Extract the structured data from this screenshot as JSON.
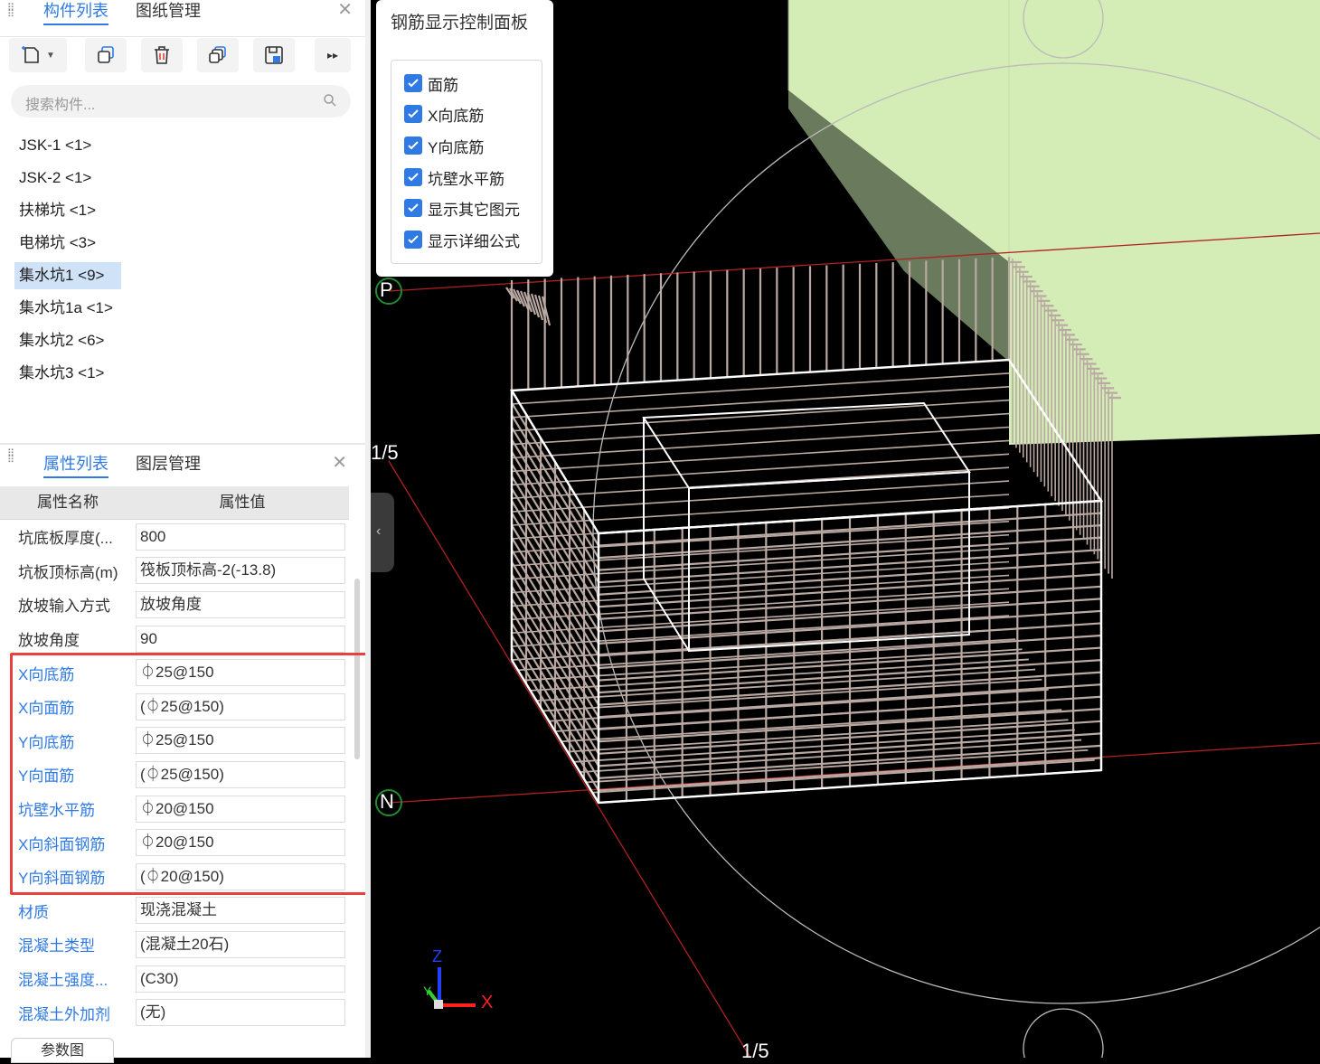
{
  "top_panel": {
    "tabs": [
      "构件列表",
      "图纸管理"
    ],
    "search_placeholder": "搜索构件...",
    "items": [
      "JSK-1 <1>",
      "JSK-2 <1>",
      "扶梯坑 <1>",
      "电梯坑 <3>",
      "集水坑1 <9>",
      "集水坑1a <1>",
      "集水坑2 <6>",
      "集水坑3 <1>"
    ],
    "selected_index": 4
  },
  "bottom_panel": {
    "tabs": [
      "属性列表",
      "图层管理"
    ],
    "headers": [
      "属性名称",
      "属性值"
    ],
    "rows": [
      {
        "name": "坑底板厚度(...",
        "value": "800",
        "blue": false
      },
      {
        "name": "坑板顶标高(m)",
        "value": "筏板顶标高-2(-13.8)",
        "blue": false
      },
      {
        "name": "放坡输入方式",
        "value": "放坡角度",
        "blue": false
      },
      {
        "name": "放坡角度",
        "value": "90",
        "blue": false
      },
      {
        "name": "X向底筋",
        "value": "⏀25@150",
        "blue": true
      },
      {
        "name": "X向面筋",
        "value": "(⏀25@150)",
        "blue": true
      },
      {
        "name": "Y向底筋",
        "value": "⏀25@150",
        "blue": true
      },
      {
        "name": "Y向面筋",
        "value": "(⏀25@150)",
        "blue": true
      },
      {
        "name": "坑壁水平筋",
        "value": "⏀20@150",
        "blue": true
      },
      {
        "name": "X向斜面钢筋",
        "value": "⏀20@150",
        "blue": true
      },
      {
        "name": "Y向斜面钢筋",
        "value": "(⏀20@150)",
        "blue": true
      },
      {
        "name": "材质",
        "value": "现浇混凝土",
        "blue": true
      },
      {
        "name": "混凝土类型",
        "value": "(混凝土20石)",
        "blue": true
      },
      {
        "name": "混凝土强度...",
        "value": "(C30)",
        "blue": true
      },
      {
        "name": "混凝土外加剂",
        "value": "(无)",
        "blue": true
      }
    ],
    "bottom_button": "参数图"
  },
  "control_panel": {
    "title": "钢筋显示控制面板",
    "options": [
      "面筋",
      "X向底筋",
      "Y向底筋",
      "坑壁水平筋",
      "显示其它图元",
      "显示详细公式"
    ]
  },
  "viewport": {
    "axis_labels": {
      "p": "P",
      "n": "N",
      "fraction": "1/5",
      "z": "Z",
      "x": "X",
      "y": "Y"
    }
  }
}
